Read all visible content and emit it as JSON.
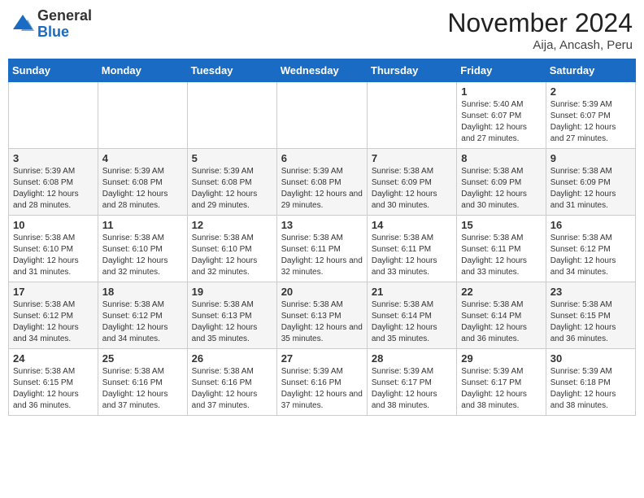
{
  "header": {
    "logo_general": "General",
    "logo_blue": "Blue",
    "month_title": "November 2024",
    "location": "Aija, Ancash, Peru"
  },
  "weekdays": [
    "Sunday",
    "Monday",
    "Tuesday",
    "Wednesday",
    "Thursday",
    "Friday",
    "Saturday"
  ],
  "weeks": [
    [
      {
        "day": "",
        "info": ""
      },
      {
        "day": "",
        "info": ""
      },
      {
        "day": "",
        "info": ""
      },
      {
        "day": "",
        "info": ""
      },
      {
        "day": "",
        "info": ""
      },
      {
        "day": "1",
        "info": "Sunrise: 5:40 AM\nSunset: 6:07 PM\nDaylight: 12 hours and 27 minutes."
      },
      {
        "day": "2",
        "info": "Sunrise: 5:39 AM\nSunset: 6:07 PM\nDaylight: 12 hours and 27 minutes."
      }
    ],
    [
      {
        "day": "3",
        "info": "Sunrise: 5:39 AM\nSunset: 6:08 PM\nDaylight: 12 hours and 28 minutes."
      },
      {
        "day": "4",
        "info": "Sunrise: 5:39 AM\nSunset: 6:08 PM\nDaylight: 12 hours and 28 minutes."
      },
      {
        "day": "5",
        "info": "Sunrise: 5:39 AM\nSunset: 6:08 PM\nDaylight: 12 hours and 29 minutes."
      },
      {
        "day": "6",
        "info": "Sunrise: 5:39 AM\nSunset: 6:08 PM\nDaylight: 12 hours and 29 minutes."
      },
      {
        "day": "7",
        "info": "Sunrise: 5:38 AM\nSunset: 6:09 PM\nDaylight: 12 hours and 30 minutes."
      },
      {
        "day": "8",
        "info": "Sunrise: 5:38 AM\nSunset: 6:09 PM\nDaylight: 12 hours and 30 minutes."
      },
      {
        "day": "9",
        "info": "Sunrise: 5:38 AM\nSunset: 6:09 PM\nDaylight: 12 hours and 31 minutes."
      }
    ],
    [
      {
        "day": "10",
        "info": "Sunrise: 5:38 AM\nSunset: 6:10 PM\nDaylight: 12 hours and 31 minutes."
      },
      {
        "day": "11",
        "info": "Sunrise: 5:38 AM\nSunset: 6:10 PM\nDaylight: 12 hours and 32 minutes."
      },
      {
        "day": "12",
        "info": "Sunrise: 5:38 AM\nSunset: 6:10 PM\nDaylight: 12 hours and 32 minutes."
      },
      {
        "day": "13",
        "info": "Sunrise: 5:38 AM\nSunset: 6:11 PM\nDaylight: 12 hours and 32 minutes."
      },
      {
        "day": "14",
        "info": "Sunrise: 5:38 AM\nSunset: 6:11 PM\nDaylight: 12 hours and 33 minutes."
      },
      {
        "day": "15",
        "info": "Sunrise: 5:38 AM\nSunset: 6:11 PM\nDaylight: 12 hours and 33 minutes."
      },
      {
        "day": "16",
        "info": "Sunrise: 5:38 AM\nSunset: 6:12 PM\nDaylight: 12 hours and 34 minutes."
      }
    ],
    [
      {
        "day": "17",
        "info": "Sunrise: 5:38 AM\nSunset: 6:12 PM\nDaylight: 12 hours and 34 minutes."
      },
      {
        "day": "18",
        "info": "Sunrise: 5:38 AM\nSunset: 6:12 PM\nDaylight: 12 hours and 34 minutes."
      },
      {
        "day": "19",
        "info": "Sunrise: 5:38 AM\nSunset: 6:13 PM\nDaylight: 12 hours and 35 minutes."
      },
      {
        "day": "20",
        "info": "Sunrise: 5:38 AM\nSunset: 6:13 PM\nDaylight: 12 hours and 35 minutes."
      },
      {
        "day": "21",
        "info": "Sunrise: 5:38 AM\nSunset: 6:14 PM\nDaylight: 12 hours and 35 minutes."
      },
      {
        "day": "22",
        "info": "Sunrise: 5:38 AM\nSunset: 6:14 PM\nDaylight: 12 hours and 36 minutes."
      },
      {
        "day": "23",
        "info": "Sunrise: 5:38 AM\nSunset: 6:15 PM\nDaylight: 12 hours and 36 minutes."
      }
    ],
    [
      {
        "day": "24",
        "info": "Sunrise: 5:38 AM\nSunset: 6:15 PM\nDaylight: 12 hours and 36 minutes."
      },
      {
        "day": "25",
        "info": "Sunrise: 5:38 AM\nSunset: 6:16 PM\nDaylight: 12 hours and 37 minutes."
      },
      {
        "day": "26",
        "info": "Sunrise: 5:38 AM\nSunset: 6:16 PM\nDaylight: 12 hours and 37 minutes."
      },
      {
        "day": "27",
        "info": "Sunrise: 5:39 AM\nSunset: 6:16 PM\nDaylight: 12 hours and 37 minutes."
      },
      {
        "day": "28",
        "info": "Sunrise: 5:39 AM\nSunset: 6:17 PM\nDaylight: 12 hours and 38 minutes."
      },
      {
        "day": "29",
        "info": "Sunrise: 5:39 AM\nSunset: 6:17 PM\nDaylight: 12 hours and 38 minutes."
      },
      {
        "day": "30",
        "info": "Sunrise: 5:39 AM\nSunset: 6:18 PM\nDaylight: 12 hours and 38 minutes."
      }
    ]
  ]
}
